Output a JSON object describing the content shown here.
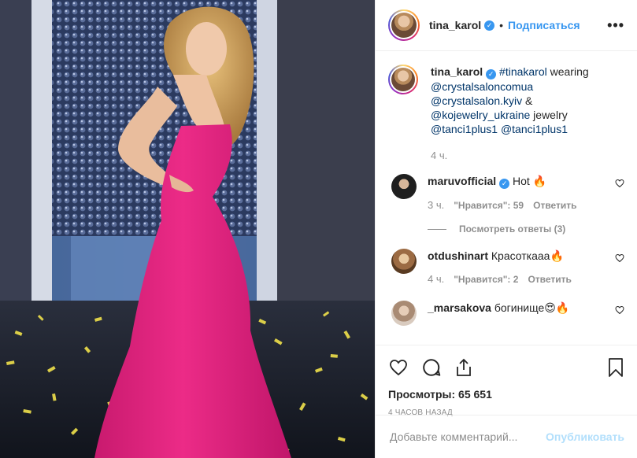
{
  "post": {
    "media_alt": "",
    "author": {
      "username": "tina_karol",
      "verified_icon": "verified-badge-icon",
      "follow_label": "Подписаться",
      "more_label": "•••"
    },
    "caption": {
      "username": "tina_karol",
      "segments": [
        "#tinakarol",
        " wearing",
        "@crystalsaloncomua",
        "@crystalsalon.kyiv",
        " &",
        "@kojewelry_ukraine",
        " jewelry",
        "@tanci1plus1",
        "@tanci1plus1"
      ],
      "time": "4 ч."
    },
    "comments": [
      {
        "username": "maruvofficial",
        "verified": true,
        "text": "Hot 🔥",
        "time": "3 ч.",
        "likes": "\"Нравится\": 59",
        "reply": "Ответить",
        "view_replies": "Посмотреть ответы (3)",
        "avatar_color": "#2b2b2b"
      },
      {
        "username": "otdushinart",
        "verified": false,
        "text": "Красоткааа🔥",
        "time": "4 ч.",
        "likes": "\"Нравится\": 2",
        "reply": "Ответить",
        "avatar_color": "#9c6b43"
      },
      {
        "username": "_marsakova",
        "verified": false,
        "text": "богинище😍🔥",
        "time": "",
        "avatar_color": "#c9b3a3"
      }
    ],
    "views_label": "Просмотры: 65 651",
    "posted_ago": "4 ЧАСОВ НАЗАД",
    "comment_input": {
      "placeholder": "Добавьте комментарий...",
      "publish_label": "Опубликовать"
    }
  },
  "colors": {
    "accent": "#3897f0",
    "link": "#003569",
    "muted": "#8e8e8e",
    "dress": "#e0257f"
  }
}
